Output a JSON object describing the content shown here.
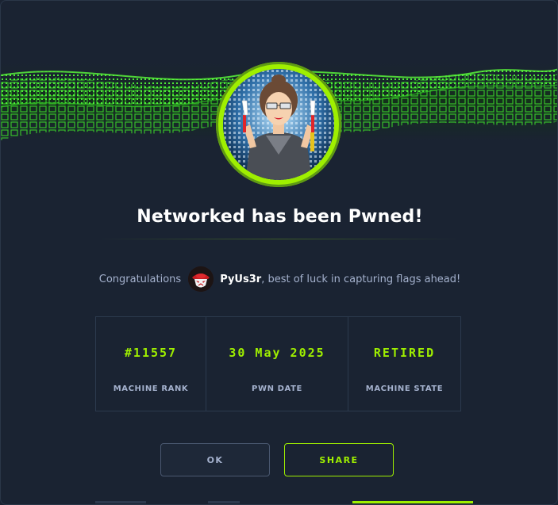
{
  "dialog": {
    "title": "Networked has been Pwned!",
    "congrats_prefix": "Congratulations",
    "username": "PyUs3r",
    "congrats_suffix": ", best of luck in capturing flags ahead!"
  },
  "stats": [
    {
      "value": "#11557",
      "label": "MACHINE RANK"
    },
    {
      "value": "30 May 2025",
      "label": "PWN DATE"
    },
    {
      "value": "RETIRED",
      "label": "MACHINE STATE"
    }
  ],
  "buttons": {
    "ok_label": "OK",
    "share_label": "SHARE"
  },
  "colors": {
    "accent": "#9fef00",
    "background": "#1a2332",
    "muted_text": "#a4b1cd"
  },
  "icons": {
    "banner": "green-cube-wave-banner",
    "machine_avatar": "woman-with-cables-avatar",
    "user_avatar": "red-hacker-mask-avatar"
  }
}
